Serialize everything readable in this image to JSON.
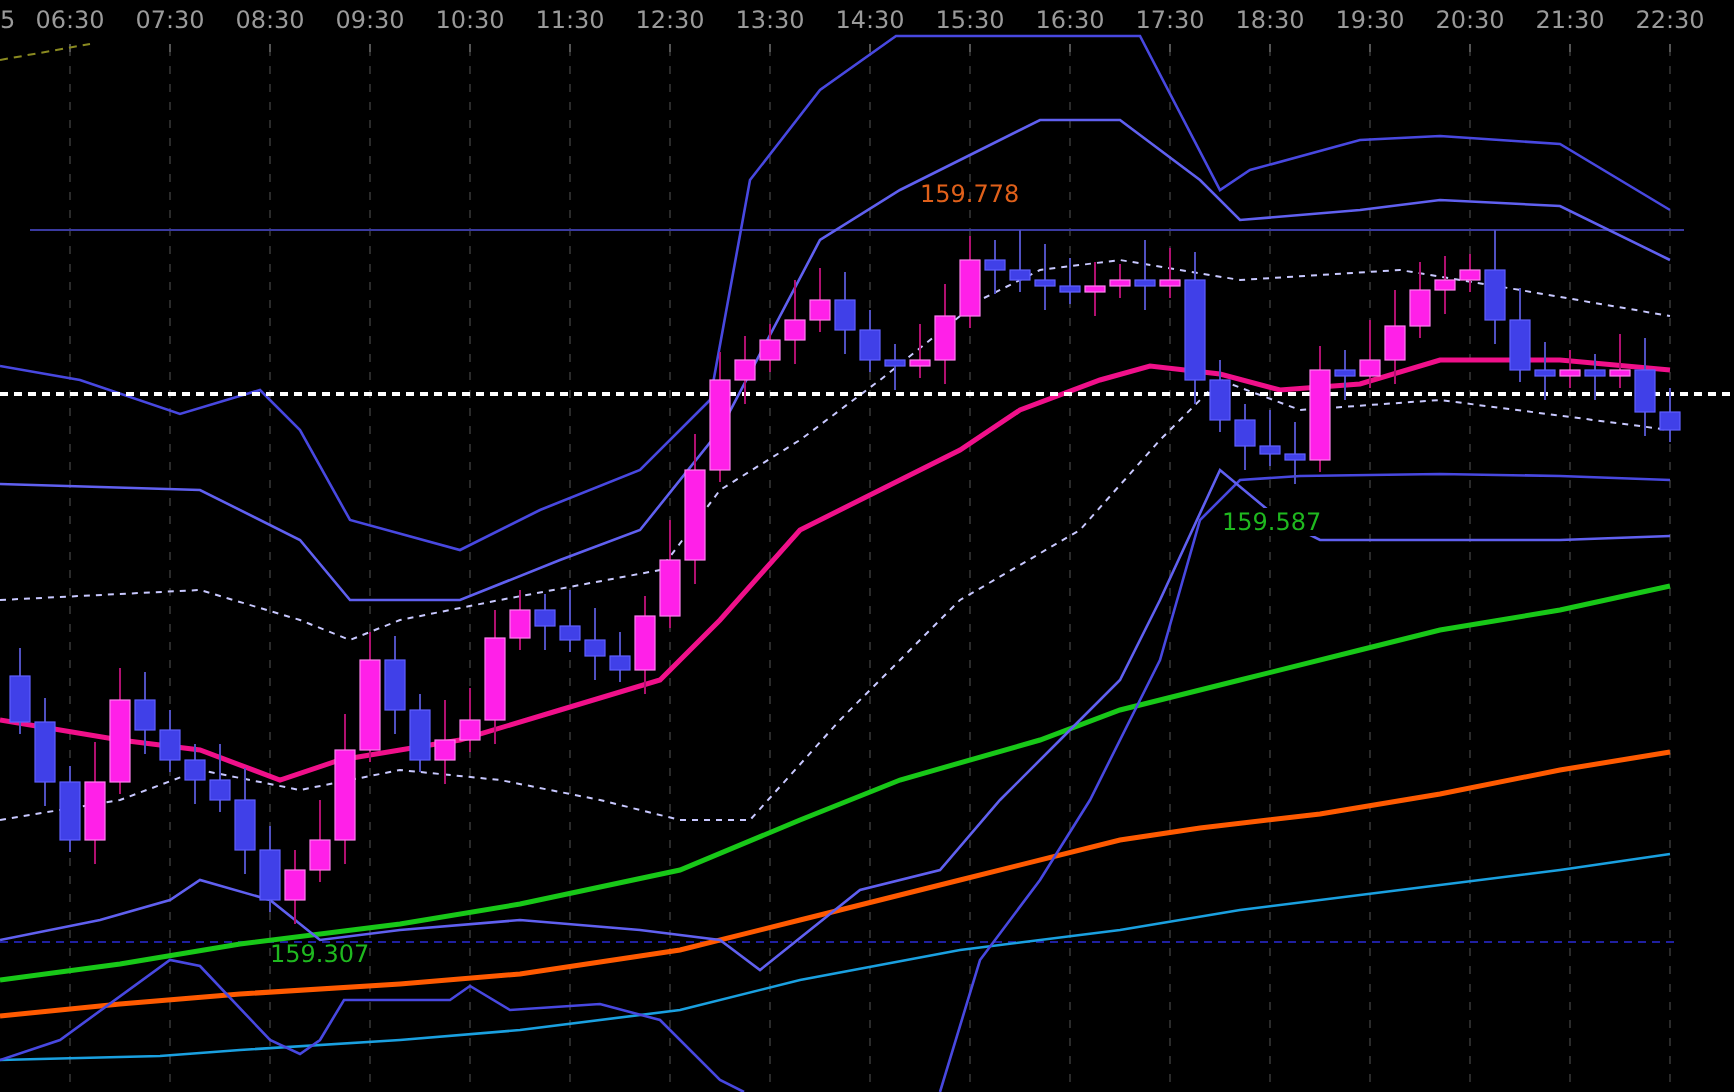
{
  "time_axis": [
    "5",
    "06:30",
    "07:30",
    "08:30",
    "09:30",
    "10:30",
    "11:30",
    "12:30",
    "13:30",
    "14:30",
    "15:30",
    "16:30",
    "17:30",
    "18:30",
    "19:30",
    "20:30",
    "21:30",
    "22:30"
  ],
  "price_labels": [
    {
      "text": "159.778",
      "color": "#e0601a"
    },
    {
      "text": "159.587",
      "color": "#1fb81f"
    },
    {
      "text": "159.307",
      "color": "#1fb81f"
    }
  ]
}
